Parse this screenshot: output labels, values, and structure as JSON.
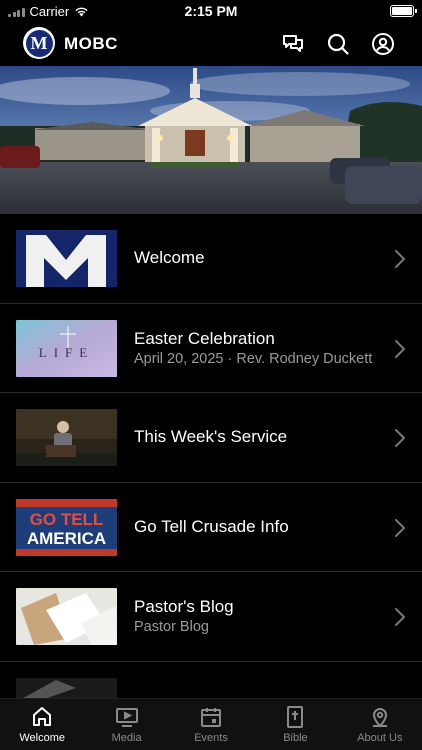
{
  "status_bar": {
    "carrier": "Carrier",
    "time": "2:15 PM"
  },
  "header": {
    "logo_letter": "M",
    "title": "MOBC"
  },
  "items": [
    {
      "title": "Welcome",
      "subtitle": ""
    },
    {
      "title": "Easter Celebration",
      "subtitle": "April 20, 2025 · Rev. Rodney Duckett"
    },
    {
      "title": "This Week's Service",
      "subtitle": ""
    },
    {
      "title": "Go Tell Crusade Info",
      "subtitle": ""
    },
    {
      "title": "Pastor's Blog",
      "subtitle": "Pastor Blog"
    }
  ],
  "thumbnails": {
    "life": "LIFE",
    "go_tell_line1": "GO TELL",
    "go_tell_line2": "AMERICA"
  },
  "tabs": [
    {
      "label": "Welcome",
      "icon": "home-icon",
      "active": true
    },
    {
      "label": "Media",
      "icon": "media-icon",
      "active": false
    },
    {
      "label": "Events",
      "icon": "calendar-icon",
      "active": false
    },
    {
      "label": "Bible",
      "icon": "bible-icon",
      "active": false
    },
    {
      "label": "About Us",
      "icon": "location-pin-icon",
      "active": false
    }
  ],
  "colors": {
    "background": "#000000",
    "tab_bar": "#111111",
    "subtitle": "#9a9a9a",
    "logo": "#1a2a7a"
  }
}
